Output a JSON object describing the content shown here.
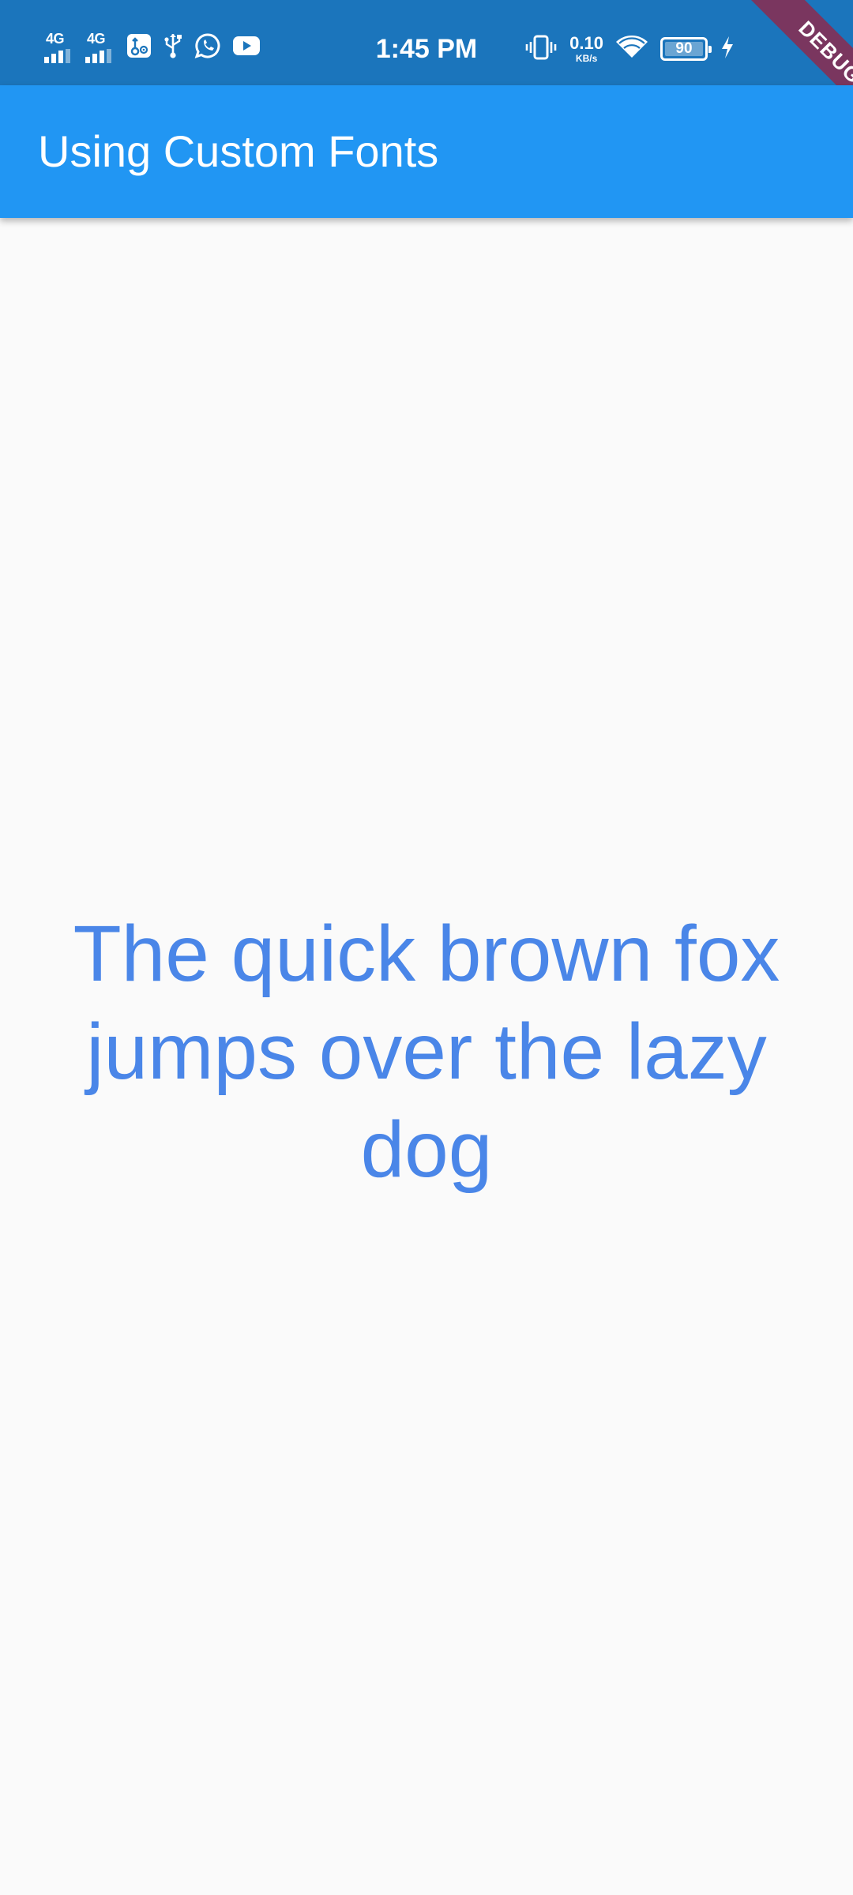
{
  "status_bar": {
    "time": "1:45 PM",
    "signal_1": "4G",
    "signal_2": "4G",
    "net_speed_value": "0.10",
    "net_speed_unit": "KB/s",
    "battery_level": "90",
    "icons": [
      "4g-signal-icon",
      "4g-signal-icon",
      "usb-settings-icon",
      "usb-icon",
      "whatsapp-icon",
      "youtube-icon",
      "vibrate-icon",
      "wifi-icon",
      "battery-icon",
      "charging-bolt-icon"
    ]
  },
  "debug_banner": "DEBUG",
  "app_bar": {
    "title": "Using Custom Fonts"
  },
  "main": {
    "text": "The quick brown fox jumps over the lazy dog"
  },
  "colors": {
    "status_bar": "#1b75bc",
    "app_bar": "#2196f3",
    "text": "#4a86e8",
    "background": "#fafafa",
    "debug_banner": "#a01e3c"
  }
}
